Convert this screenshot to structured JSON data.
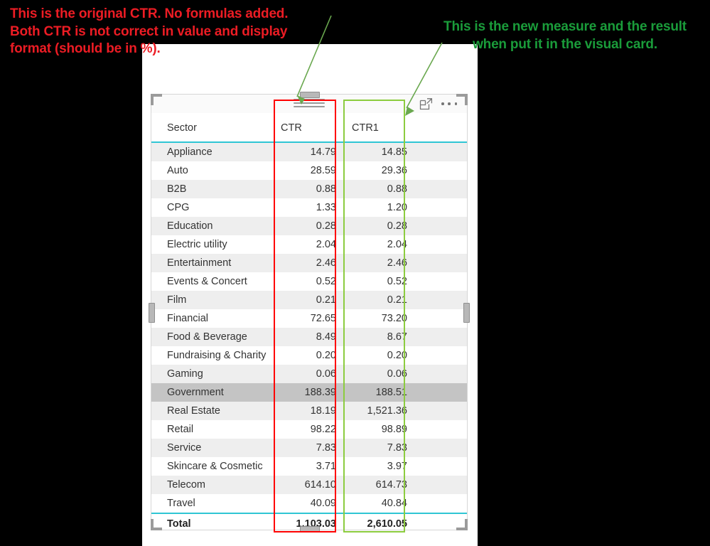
{
  "annotations": {
    "red_note": "This is the original CTR. No formulas added. Both CTR is not correct in value and display format (should be in %).",
    "green_note": "This is the new measure and the result when put it in the visual card.",
    "red_color": "#ec1c24",
    "green_color": "#1a9c3a"
  },
  "visual_card": {
    "chrome": {
      "drag_handle": "drag-grip-icon",
      "focus_mode": "focus-mode-icon",
      "more_options": "more-options-icon"
    },
    "highlight_boxes": [
      {
        "name": "CTR column highlight",
        "color": "#ff0000"
      },
      {
        "name": "CTR1 column highlight",
        "color": "#8ccc3f"
      }
    ],
    "accent_color": "#2fc6d4"
  },
  "chart_data": {
    "type": "table",
    "title": "",
    "columns": [
      "Sector",
      "CTR",
      "CTR1"
    ],
    "rows": [
      {
        "sector": "Appliance",
        "ctr": "14.79",
        "ctr1": "14.85",
        "selected": false
      },
      {
        "sector": "Auto",
        "ctr": "28.59",
        "ctr1": "29.36",
        "selected": false
      },
      {
        "sector": "B2B",
        "ctr": "0.88",
        "ctr1": "0.88",
        "selected": false
      },
      {
        "sector": "CPG",
        "ctr": "1.33",
        "ctr1": "1.20",
        "selected": false
      },
      {
        "sector": "Education",
        "ctr": "0.28",
        "ctr1": "0.28",
        "selected": false
      },
      {
        "sector": "Electric utility",
        "ctr": "2.04",
        "ctr1": "2.04",
        "selected": false
      },
      {
        "sector": "Entertainment",
        "ctr": "2.46",
        "ctr1": "2.46",
        "selected": false
      },
      {
        "sector": "Events & Concert",
        "ctr": "0.52",
        "ctr1": "0.52",
        "selected": false
      },
      {
        "sector": "Film",
        "ctr": "0.21",
        "ctr1": "0.21",
        "selected": false
      },
      {
        "sector": "Financial",
        "ctr": "72.65",
        "ctr1": "73.20",
        "selected": false
      },
      {
        "sector": "Food & Beverage",
        "ctr": "8.49",
        "ctr1": "8.67",
        "selected": false
      },
      {
        "sector": "Fundraising & Charity",
        "ctr": "0.20",
        "ctr1": "0.20",
        "selected": false
      },
      {
        "sector": "Gaming",
        "ctr": "0.06",
        "ctr1": "0.06",
        "selected": false
      },
      {
        "sector": "Government",
        "ctr": "188.39",
        "ctr1": "188.51",
        "selected": true
      },
      {
        "sector": "Real Estate",
        "ctr": "18.19",
        "ctr1": "1,521.36",
        "selected": false
      },
      {
        "sector": "Retail",
        "ctr": "98.22",
        "ctr1": "98.89",
        "selected": false
      },
      {
        "sector": "Service",
        "ctr": "7.83",
        "ctr1": "7.83",
        "selected": false
      },
      {
        "sector": "Skincare & Cosmetic",
        "ctr": "3.71",
        "ctr1": "3.97",
        "selected": false
      },
      {
        "sector": "Telecom",
        "ctr": "614.10",
        "ctr1": "614.73",
        "selected": false
      },
      {
        "sector": "Travel",
        "ctr": "40.09",
        "ctr1": "40.84",
        "selected": false
      }
    ],
    "total": {
      "label": "Total",
      "ctr": "1,103.03",
      "ctr1": "2,610.05"
    }
  }
}
